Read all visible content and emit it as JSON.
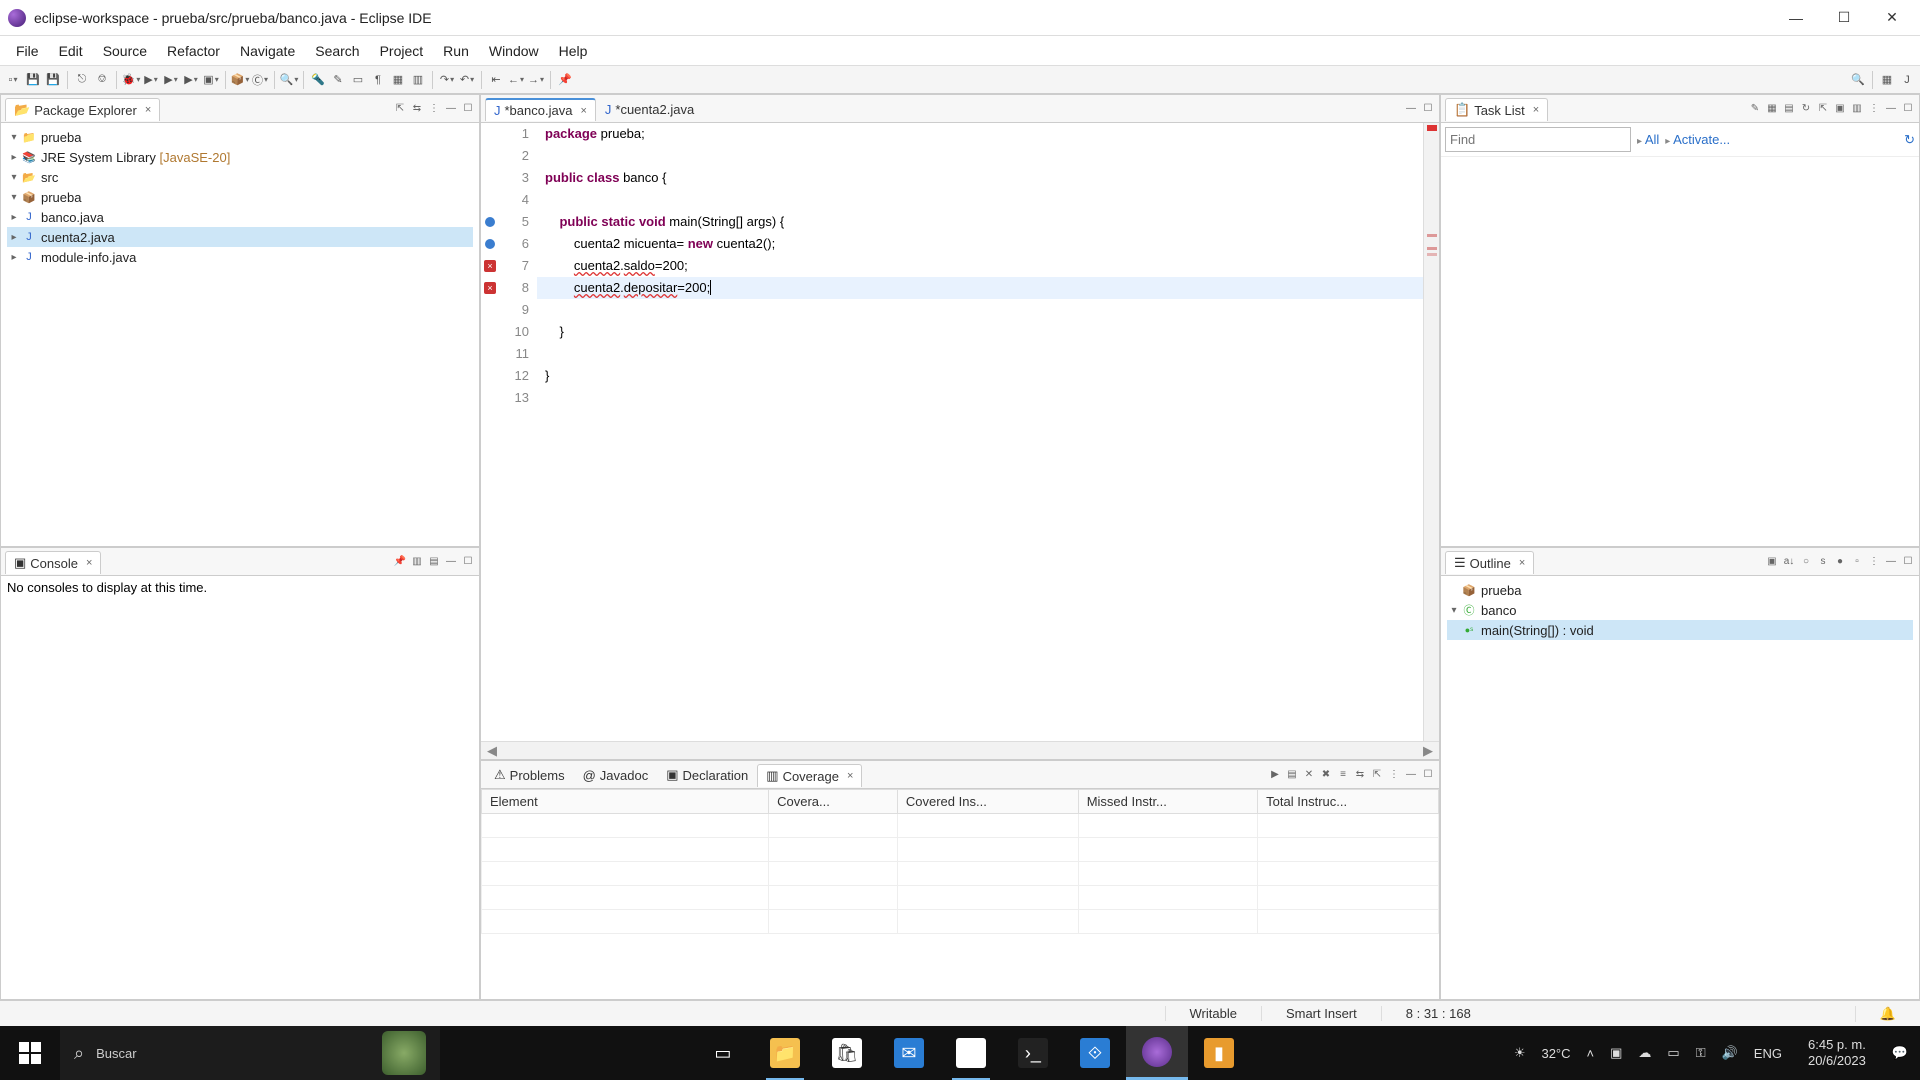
{
  "window": {
    "title": "eclipse-workspace - prueba/src/prueba/banco.java - Eclipse IDE"
  },
  "menu": [
    "File",
    "Edit",
    "Source",
    "Refactor",
    "Navigate",
    "Search",
    "Project",
    "Run",
    "Window",
    "Help"
  ],
  "package_explorer": {
    "title": "Package Explorer",
    "tree": {
      "project": "prueba",
      "jre": "JRE System Library",
      "jre_extra": "[JavaSE-20]",
      "src": "src",
      "pkg": "prueba",
      "files": [
        "banco.java",
        "cuenta2.java",
        "module-info.java"
      ]
    }
  },
  "console": {
    "title": "Console",
    "empty_msg": "No consoles to display at this time."
  },
  "editor": {
    "tabs": [
      {
        "label": "*banco.java",
        "active": true,
        "dirty": true
      },
      {
        "label": "*cuenta2.java",
        "active": false,
        "dirty": true
      }
    ],
    "lines": 13,
    "code": {
      "l1": {
        "pre": "",
        "kw1": "package",
        "post": " prueba;"
      },
      "l2": "",
      "l3": {
        "kw1": "public",
        "kw2": "class",
        "name": " banco {"
      },
      "l4": "",
      "l5": {
        "indent": "    ",
        "kw1": "public",
        "kw2": "static",
        "kw3": "void",
        "sig": " main(String[] args) {"
      },
      "l6": {
        "indent": "        ",
        "txt1": "cuenta2 micuenta= ",
        "kw": "new",
        "txt2": " cuenta2();"
      },
      "l7": {
        "indent": "        ",
        "obj": "cuenta2",
        "dot": ".",
        "field": "saldo",
        "rest": "=200;"
      },
      "l8": {
        "indent": "        ",
        "obj": "cuenta2",
        "dot": ".",
        "field": "depositar",
        "rest": "=200;"
      },
      "l9": "",
      "l10": "    }",
      "l11": "",
      "l12": "}",
      "l13": ""
    }
  },
  "tasklist": {
    "title": "Task List",
    "find_placeholder": "Find",
    "links": [
      "All",
      "Activate..."
    ]
  },
  "outline": {
    "title": "Outline",
    "pkg": "prueba",
    "cls": "banco",
    "method": "main(String[]) : void"
  },
  "bottom": {
    "tabs": [
      "Problems",
      "Javadoc",
      "Declaration",
      "Coverage"
    ],
    "active": 3,
    "cols": [
      "Element",
      "Covera...",
      "Covered Ins...",
      "Missed Instr...",
      "Total Instruc..."
    ]
  },
  "status": {
    "writable": "Writable",
    "insert": "Smart Insert",
    "pos": "8 : 31 : 168"
  },
  "taskbar": {
    "search_placeholder": "Buscar",
    "weather": "32°C",
    "lang": "ENG",
    "time": "6:45 p. m.",
    "date": "20/6/2023"
  }
}
